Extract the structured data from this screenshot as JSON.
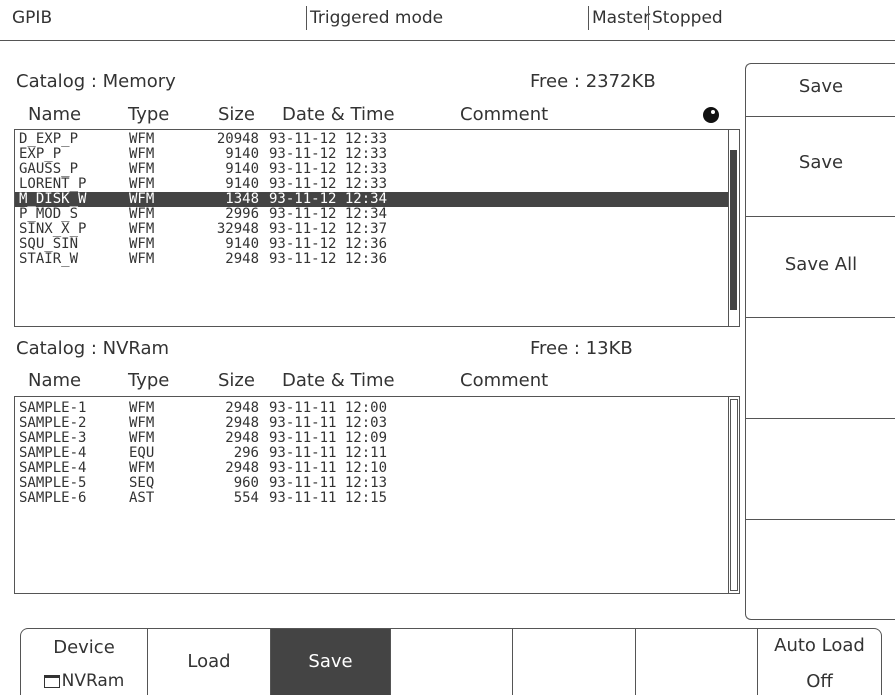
{
  "status": {
    "interface": "GPIB",
    "mode": "Triggered mode",
    "role": "Master",
    "state": "Stopped"
  },
  "memory": {
    "title": "Catalog : Memory",
    "free": "Free : 2372KB",
    "headers": {
      "name": "Name",
      "type": "Type",
      "size": "Size",
      "date": "Date & Time",
      "comment": "Comment"
    },
    "rows": [
      {
        "name": "D_EXP_P",
        "type": "WFM",
        "size": "20948",
        "date": "93-11-12 12:33"
      },
      {
        "name": "EXP_P",
        "type": "WFM",
        "size": "9140",
        "date": "93-11-12 12:33"
      },
      {
        "name": "GAUSS_P",
        "type": "WFM",
        "size": "9140",
        "date": "93-11-12 12:33"
      },
      {
        "name": "LORENT_P",
        "type": "WFM",
        "size": "9140",
        "date": "93-11-12 12:33"
      },
      {
        "name": "M_DISK_W",
        "type": "WFM",
        "size": "1348",
        "date": "93-11-12 12:34"
      },
      {
        "name": "P_MOD_S",
        "type": "WFM",
        "size": "2996",
        "date": "93-11-12 12:34"
      },
      {
        "name": "SINX_X_P",
        "type": "WFM",
        "size": "32948",
        "date": "93-11-12 12:37"
      },
      {
        "name": "SQU_SIN",
        "type": "WFM",
        "size": "9140",
        "date": "93-11-12 12:36"
      },
      {
        "name": "STAIR_W",
        "type": "WFM",
        "size": "2948",
        "date": "93-11-12 12:36"
      }
    ]
  },
  "nvram": {
    "title": "Catalog : NVRam",
    "free": "Free : 13KB",
    "headers": {
      "name": "Name",
      "type": "Type",
      "size": "Size",
      "date": "Date & Time",
      "comment": "Comment"
    },
    "rows": [
      {
        "name": "SAMPLE-1",
        "type": "WFM",
        "size": "2948",
        "date": "93-11-11 12:00"
      },
      {
        "name": "SAMPLE-2",
        "type": "WFM",
        "size": "2948",
        "date": "93-11-11 12:03"
      },
      {
        "name": "SAMPLE-3",
        "type": "WFM",
        "size": "2948",
        "date": "93-11-11 12:09"
      },
      {
        "name": "SAMPLE-4",
        "type": "EQU",
        "size": "296",
        "date": "93-11-11 12:11"
      },
      {
        "name": "SAMPLE-4",
        "type": "WFM",
        "size": "2948",
        "date": "93-11-11 12:10"
      },
      {
        "name": "SAMPLE-5",
        "type": "SEQ",
        "size": "960",
        "date": "93-11-11 12:13"
      },
      {
        "name": "SAMPLE-6",
        "type": "AST",
        "size": "554",
        "date": "93-11-11 12:15"
      }
    ]
  },
  "side_menu": {
    "title": "Save",
    "save": "Save",
    "save_all": "Save All"
  },
  "bottom_menu": {
    "device_label": "Device",
    "device_value": "NVRam",
    "load": "Load",
    "save": "Save",
    "auto_load_label": "Auto Load",
    "auto_load_value": "Off"
  }
}
